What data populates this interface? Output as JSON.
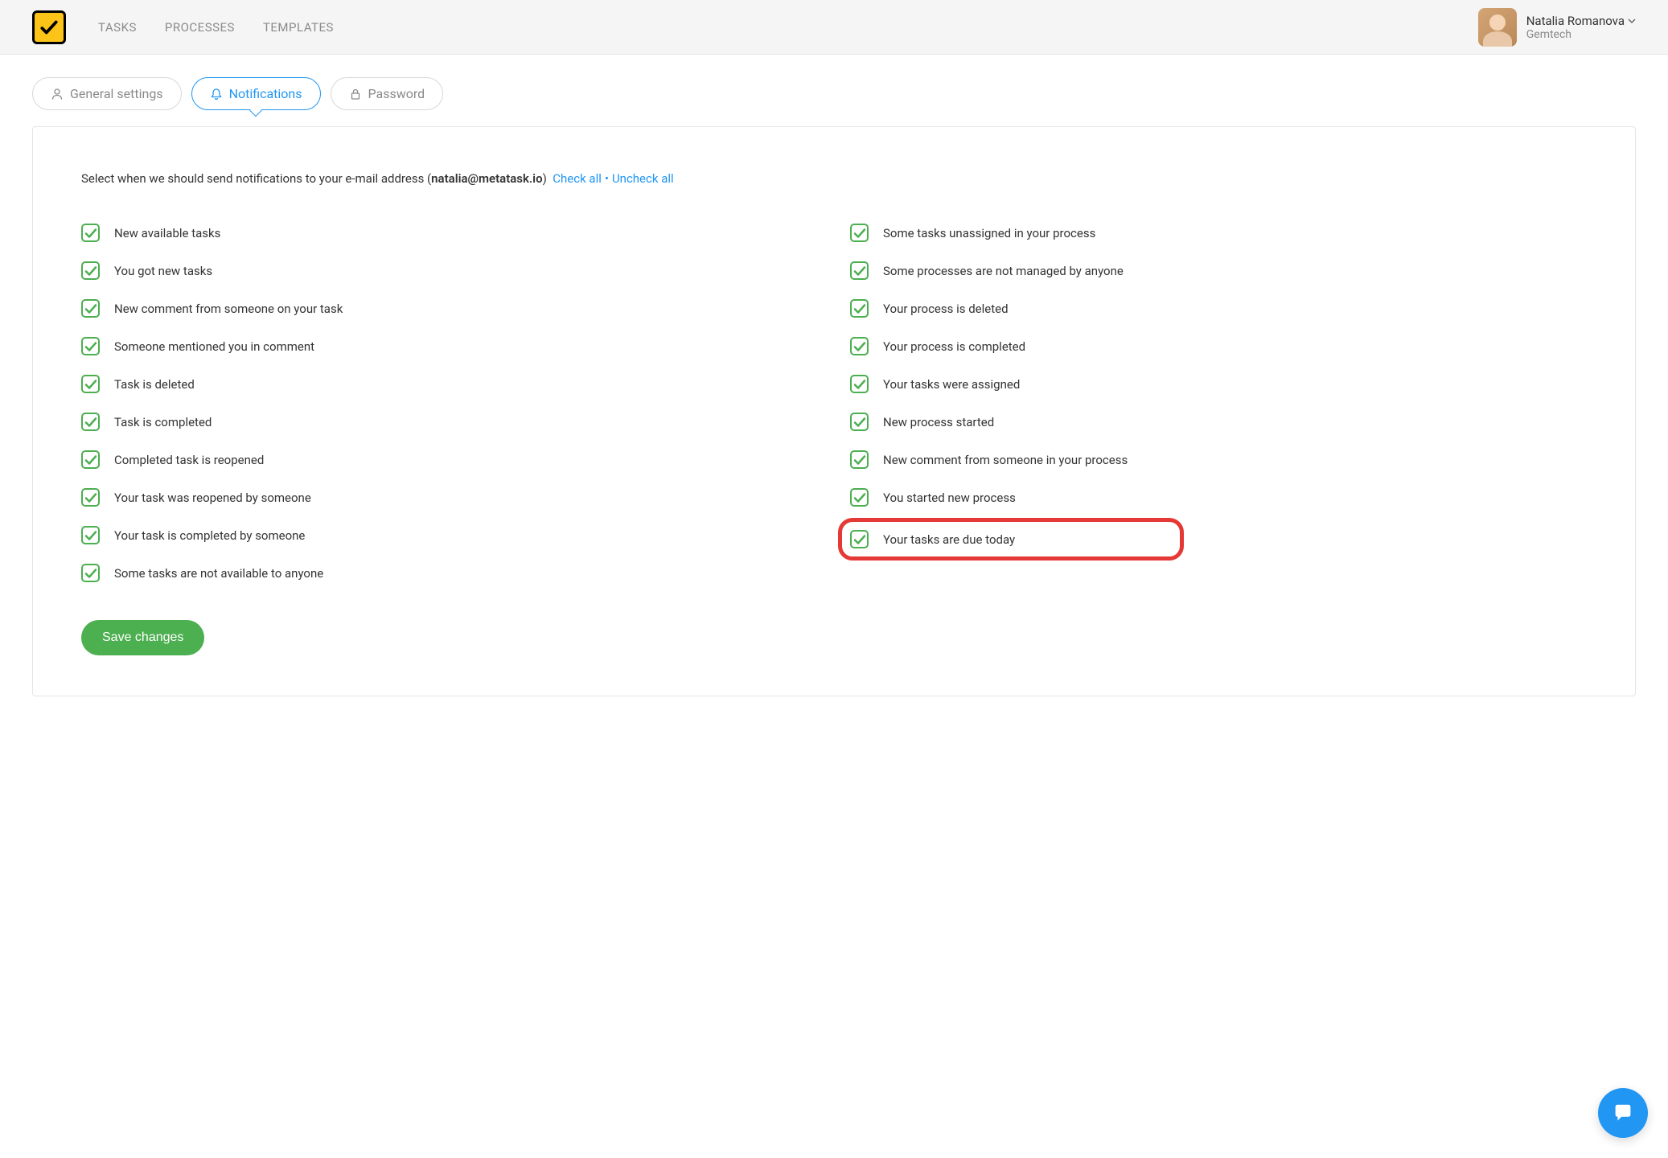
{
  "nav": {
    "tasks": "TASKS",
    "processes": "PROCESSES",
    "templates": "TEMPLATES"
  },
  "user": {
    "name": "Natalia Romanova",
    "org": "Gemtech"
  },
  "tabs": {
    "general": "General settings",
    "notifications": "Notifications",
    "password": "Password"
  },
  "intro": {
    "prefix": "Select when we should send notifications to your e-mail address (",
    "email": "natalia@metatask.io",
    "suffix": ")",
    "check_all": "Check all",
    "uncheck_all": "Uncheck all"
  },
  "checkboxes_left": [
    "New available tasks",
    "You got new tasks",
    "New comment from someone on your task",
    "Someone mentioned you in comment",
    "Task is deleted",
    "Task is completed",
    "Completed task is reopened",
    "Your task was reopened by someone",
    "Your task is completed by someone",
    "Some tasks are not available to anyone"
  ],
  "checkboxes_right": [
    "Some tasks unassigned in your process",
    "Some processes are not managed by anyone",
    "Your process is deleted",
    "Your process is completed",
    "Your tasks were assigned",
    "New process started",
    "New comment from someone in your process",
    "You started new process",
    "Your tasks are due today"
  ],
  "highlighted_index": 8,
  "save_button": "Save changes"
}
